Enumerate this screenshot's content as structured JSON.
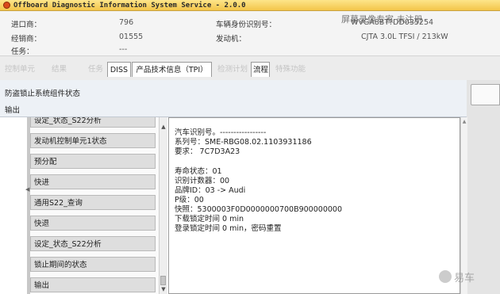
{
  "window": {
    "title": "Offboard Diagnostic Information System Service - 2.0.0"
  },
  "info": {
    "importer_label": "进口商：",
    "importer_value": "796",
    "dealer_label": "经销商：",
    "dealer_value": "01555",
    "task_label": "任务：",
    "task_value": "---",
    "vin_label": "车辆身份识别号：",
    "vin_value": "WVGA8BT?DD035254",
    "engine_label": "发动机：",
    "engine_value": "CJTA 3.0L TFSI / 213kW"
  },
  "watermark_top": "屏幕录像专家 未注册",
  "tabs": [
    {
      "label": "控制单元",
      "state": "disabled"
    },
    {
      "label": "结果",
      "state": "disabled"
    },
    {
      "label": "任务",
      "state": "disabled"
    },
    {
      "label": "DISS",
      "state": "active"
    },
    {
      "label": "产品技术信息（TPI）",
      "state": "active"
    },
    {
      "label": "检测计划",
      "state": "disabled"
    },
    {
      "label": "流程",
      "state": "active"
    },
    {
      "label": "特殊功能",
      "state": "disabled"
    }
  ],
  "header": {
    "line1": "防盗锁止系统组件状态",
    "line2": "输出"
  },
  "left_list": [
    "设定_状态_S22分析",
    "发动机控制单元1状态",
    "预分配",
    "快进",
    "通用S22_查询",
    "快退",
    "设定_状态_S22分析",
    "锁止期间的状态",
    "输出"
  ],
  "output_lines": [
    "汽车识别号。-----------------",
    "系列号：SME-RBG08.02.1103931186",
    "要求：  7C7D3A23",
    "",
    "寿命状态：01",
    "识别计数器：00",
    "品牌ID：03 -> Audi",
    "P级：00",
    "快照：5300003F0D0000000700B900000000",
    "下载锁定时间 0  min",
    "登录锁定时间 0  min，密码重置"
  ],
  "watermark_br": "易车"
}
